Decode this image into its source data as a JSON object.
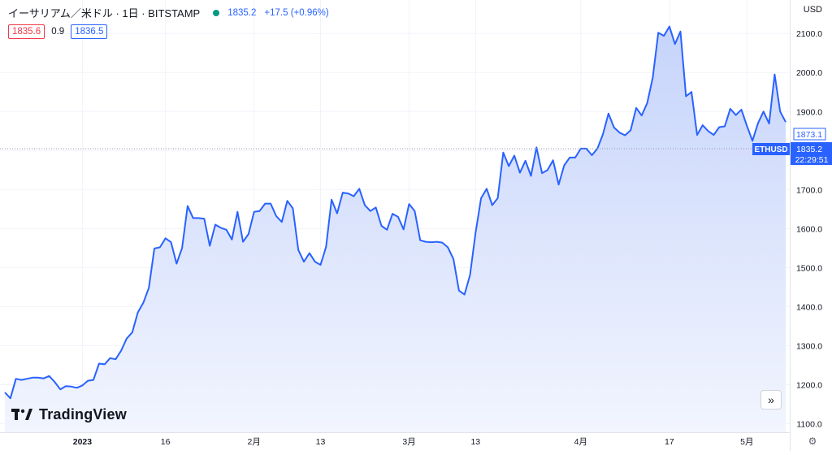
{
  "header": {
    "title": "イーサリアム／米ドル · 1日 · BITSTAMP",
    "last_price": "1835.2",
    "change": "+17.5 (+0.96%)"
  },
  "quote": {
    "bid": "1835.6",
    "spread": "0.9",
    "ask": "1836.5"
  },
  "currency": "USD",
  "brand": {
    "name": "TradingView"
  },
  "labels": {
    "prev_close": "1873.1",
    "symbol": "ETHUSD",
    "last_price": "1835.2",
    "countdown": "22:29:51"
  },
  "colors": {
    "line": "#2962ff",
    "area_top": "#c6d4fb",
    "area_bottom": "#f2f5fe",
    "grid": "#f0f3fa",
    "bid": "#f23645",
    "ask": "#2962ff",
    "live_dot": "#089981"
  },
  "icons": {
    "scroll": "double-chevron-right-icon",
    "settings": "gear-icon"
  },
  "chart_data": {
    "type": "area",
    "title": "イーサリアム／米ドル · 1日 · BITSTAMP",
    "ylim": [
      1078,
      2140
    ],
    "y_ticks": [
      1100,
      1200,
      1300,
      1400,
      1500,
      1600,
      1700,
      1800,
      1900,
      2000,
      2100
    ],
    "y_tick_labels": [
      "1100.0",
      "1200.0",
      "1300.0",
      "1400.0",
      "1500.0",
      "1600.0",
      "1700.0",
      "1800.0",
      "1900.0",
      "2000.0",
      "2100.0"
    ],
    "x_ticks": [
      {
        "label": "2023",
        "index": 14,
        "bold": true
      },
      {
        "label": "16",
        "index": 29
      },
      {
        "label": "2月",
        "index": 45
      },
      {
        "label": "13",
        "index": 57
      },
      {
        "label": "3月",
        "index": 73
      },
      {
        "label": "13",
        "index": 85
      },
      {
        "label": "4月",
        "index": 104
      },
      {
        "label": "17",
        "index": 120
      },
      {
        "label": "5月",
        "index": 134
      }
    ],
    "x_range": [
      0,
      141
    ],
    "grid": true,
    "series": [
      {
        "values": [
          1180,
          1165,
          1215,
          1212,
          1215,
          1218,
          1218,
          1216,
          1222,
          1207,
          1188,
          1196,
          1195,
          1192,
          1198,
          1210,
          1212,
          1254,
          1252,
          1268,
          1265,
          1287,
          1318,
          1334,
          1385,
          1410,
          1448,
          1549,
          1552,
          1575,
          1565,
          1510,
          1550,
          1658,
          1627,
          1627,
          1625,
          1556,
          1610,
          1602,
          1597,
          1572,
          1643,
          1566,
          1586,
          1643,
          1645,
          1664,
          1664,
          1632,
          1617,
          1671,
          1652,
          1545,
          1515,
          1537,
          1515,
          1507,
          1553,
          1674,
          1639,
          1692,
          1690,
          1683,
          1702,
          1660,
          1645,
          1654,
          1607,
          1597,
          1638,
          1630,
          1598,
          1663,
          1645,
          1570,
          1566,
          1565,
          1566,
          1564,
          1552,
          1522,
          1441,
          1431,
          1481,
          1589,
          1678,
          1702,
          1660,
          1678,
          1795,
          1760,
          1787,
          1743,
          1774,
          1735,
          1808,
          1742,
          1750,
          1775,
          1713,
          1762,
          1782,
          1782,
          1805,
          1805,
          1788,
          1805,
          1842,
          1895,
          1859,
          1846,
          1839,
          1852,
          1909,
          1890,
          1922,
          1987,
          2102,
          2094,
          2118,
          2073,
          2105,
          1939,
          1950,
          1840,
          1865,
          1850,
          1840,
          1860,
          1862,
          1907,
          1891,
          1905,
          1863,
          1825,
          1870,
          1900,
          1869,
          1995,
          1900,
          1873
        ]
      }
    ]
  }
}
